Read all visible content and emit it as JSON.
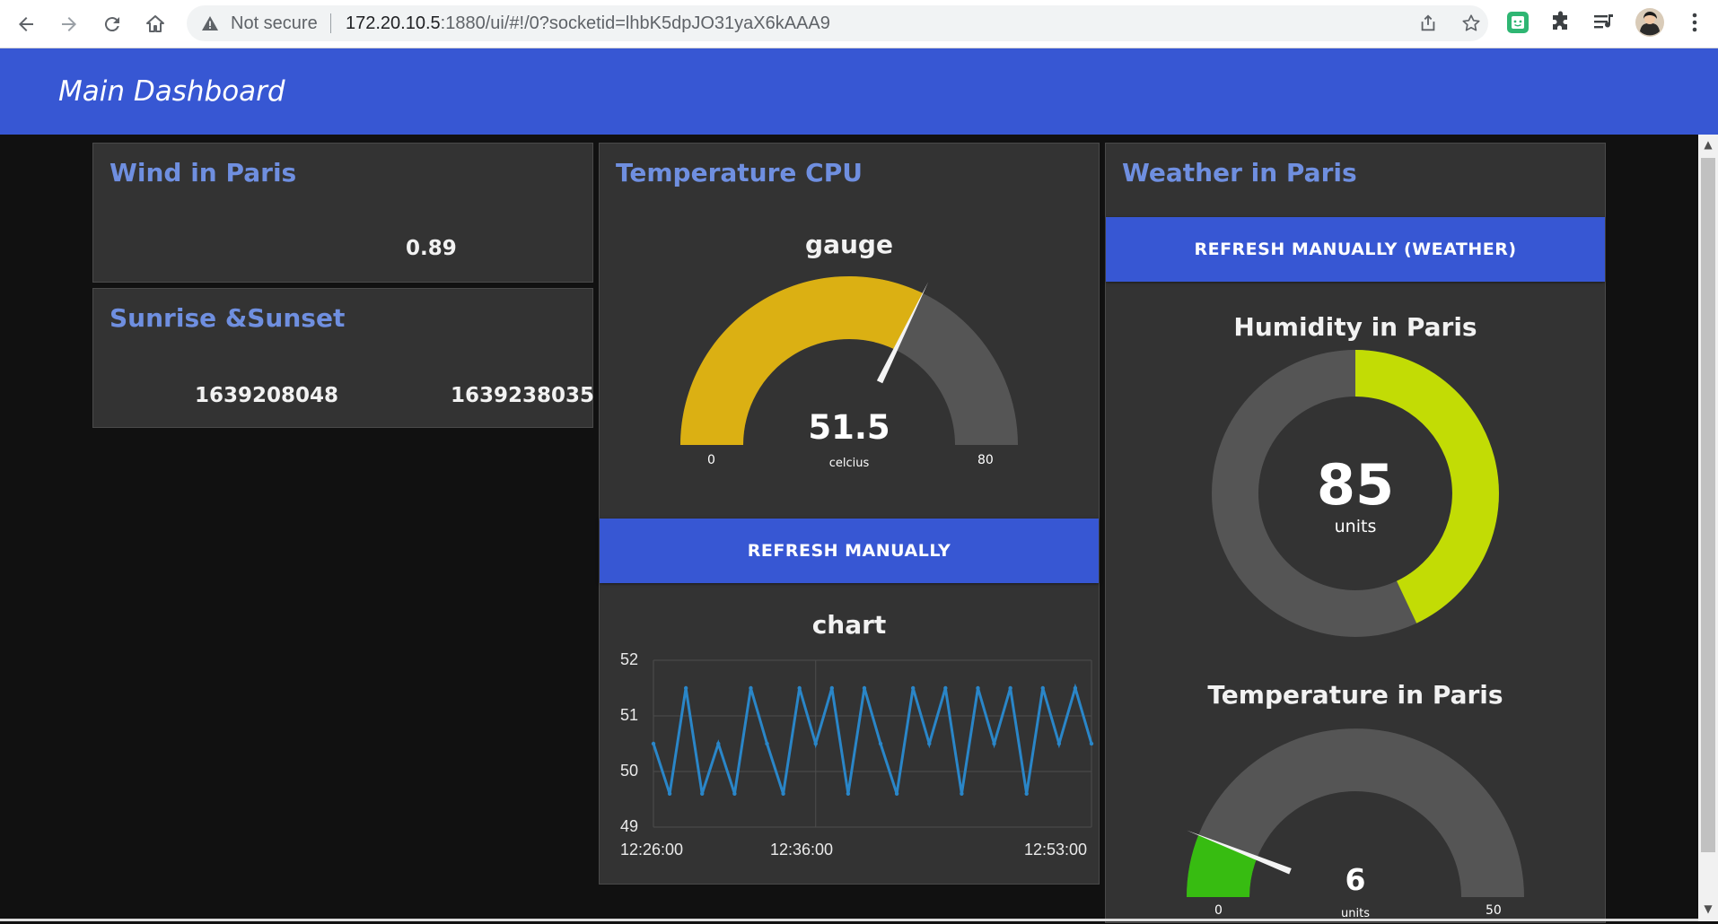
{
  "browser": {
    "security_label": "Not secure",
    "url_host": "172.20.10.5",
    "url_path": ":1880/ui/#!/0?socketid=lhbK5dpJO31yaX6kAAA9"
  },
  "header": {
    "title": "Main Dashboard"
  },
  "wind": {
    "title": "Wind in Paris",
    "value": "0.89"
  },
  "sun": {
    "title": "Sunrise &Sunset",
    "sunrise": "1639208048",
    "sunset": "1639238035"
  },
  "cpu": {
    "title": "Temperature CPU",
    "gauge": {
      "title": "gauge",
      "value": 51.5,
      "value_text": "51.5",
      "unit": "celcius",
      "min": 0,
      "max": 80,
      "min_text": "0",
      "max_text": "80",
      "fill_color": "#dbb013"
    },
    "refresh_label": "REFRESH MANUALLY",
    "chart_title": "chart"
  },
  "weather": {
    "title": "Weather in Paris",
    "refresh_label": "REFRESH MANUALLY (WEATHER)",
    "humidity": {
      "title": "Humidity in Paris",
      "value": 85,
      "value_text": "85",
      "unit": "units",
      "fraction": 0.43,
      "fill_color": "#c2dc05"
    },
    "temperature": {
      "title": "Temperature in Paris",
      "value": 6,
      "value_text": "6",
      "unit": "units",
      "min": 0,
      "max": 50,
      "min_text": "0",
      "max_text": "50",
      "fill_color": "#37bc11"
    }
  },
  "chart_data": {
    "type": "line",
    "title": "chart",
    "xlabel": "",
    "ylabel": "",
    "ylim": [
      49,
      52
    ],
    "y_ticks": [
      "49",
      "50",
      "51",
      "52"
    ],
    "x_ticks": [
      "12:26:00",
      "12:36:00",
      "12:53:00"
    ],
    "x_range": [
      "12:26:00",
      "12:53:00"
    ],
    "series": [
      {
        "color": "#2a86c8",
        "x": [
          "12:26:00",
          "12:27:00",
          "12:28:00",
          "12:29:00",
          "12:30:00",
          "12:31:00",
          "12:32:00",
          "12:33:00",
          "12:34:00",
          "12:35:00",
          "12:36:00",
          "12:37:00",
          "12:38:00",
          "12:39:00",
          "12:40:00",
          "12:41:00",
          "12:42:00",
          "12:43:00",
          "12:44:00",
          "12:45:00",
          "12:46:00",
          "12:47:00",
          "12:48:00",
          "12:49:00",
          "12:50:00",
          "12:51:00",
          "12:52:00",
          "12:53:00"
        ],
        "values": [
          50.5,
          49.6,
          51.5,
          49.6,
          50.5,
          49.6,
          51.5,
          50.5,
          49.6,
          51.5,
          50.5,
          51.5,
          49.6,
          51.5,
          50.5,
          49.6,
          51.5,
          50.5,
          51.5,
          49.6,
          51.5,
          50.5,
          51.5,
          49.6,
          51.5,
          50.5,
          51.5,
          50.5
        ]
      }
    ],
    "grid": true
  }
}
